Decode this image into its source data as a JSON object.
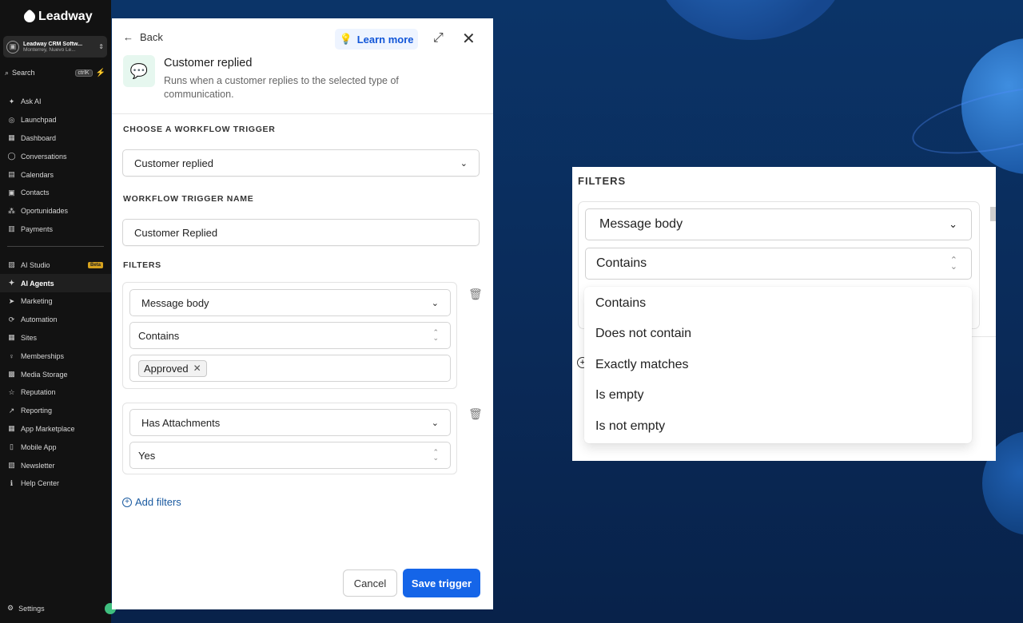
{
  "sidebar": {
    "brand": "Leadway",
    "account_name": "Leadway CRM Softw...",
    "account_location": "Monterrey, Nuevo Le...",
    "search_label": "Search",
    "search_shortcut": "ctrlK",
    "items": [
      {
        "label": "Ask AI",
        "icon": "sparkle-icon"
      },
      {
        "label": "Launchpad",
        "icon": "rocket-icon"
      },
      {
        "label": "Dashboard",
        "icon": "grid-icon"
      },
      {
        "label": "Conversations",
        "icon": "chat-icon"
      },
      {
        "label": "Calendars",
        "icon": "calendar-icon"
      },
      {
        "label": "Contacts",
        "icon": "contacts-icon"
      },
      {
        "label": "Oportunidades",
        "icon": "pipeline-icon"
      },
      {
        "label": "Payments",
        "icon": "payments-icon"
      }
    ],
    "items2": [
      {
        "label": "AI Studio",
        "icon": "studio-icon",
        "badge": "Beta"
      },
      {
        "label": "AI Agents",
        "icon": "sparkle-icon",
        "active": true
      },
      {
        "label": "Marketing",
        "icon": "send-icon"
      },
      {
        "label": "Automation",
        "icon": "automation-icon"
      },
      {
        "label": "Sites",
        "icon": "sites-icon"
      },
      {
        "label": "Memberships",
        "icon": "membership-icon"
      },
      {
        "label": "Media Storage",
        "icon": "image-icon"
      },
      {
        "label": "Reputation",
        "icon": "star-icon"
      },
      {
        "label": "Reporting",
        "icon": "chart-icon"
      },
      {
        "label": "App Marketplace",
        "icon": "apps-icon"
      },
      {
        "label": "Mobile App",
        "icon": "phone-icon"
      },
      {
        "label": "Newsletter",
        "icon": "newsletter-icon"
      },
      {
        "label": "Help Center",
        "icon": "info-icon"
      }
    ],
    "settings_label": "Settings"
  },
  "panel": {
    "back_label": "Back",
    "learn_more_label": "Learn more",
    "trigger_title": "Customer replied",
    "trigger_description": "Runs when a customer replies to the selected type of communication.",
    "choose_trigger_label": "CHOOSE A WORKFLOW TRIGGER",
    "trigger_value": "Customer replied",
    "trigger_name_label": "WORKFLOW TRIGGER NAME",
    "trigger_name_value": "Customer Replied",
    "filters_label": "FILTERS",
    "filter1": {
      "field": "Message body",
      "operator": "Contains",
      "tag": "Approved"
    },
    "filter2": {
      "field": "Has Attachments",
      "value": "Yes"
    },
    "add_filters_label": "Add filters",
    "cancel_label": "Cancel",
    "save_label": "Save trigger"
  },
  "zoom": {
    "filters_label": "FILTERS",
    "field": "Message body",
    "operator": "Contains",
    "options": [
      "Contains",
      "Does not contain",
      "Exactly matches",
      "Is empty",
      "Is not empty"
    ]
  },
  "colors": {
    "primary": "#1565e8",
    "sidebar_bg": "#121212",
    "accent_green": "#36d06e"
  }
}
